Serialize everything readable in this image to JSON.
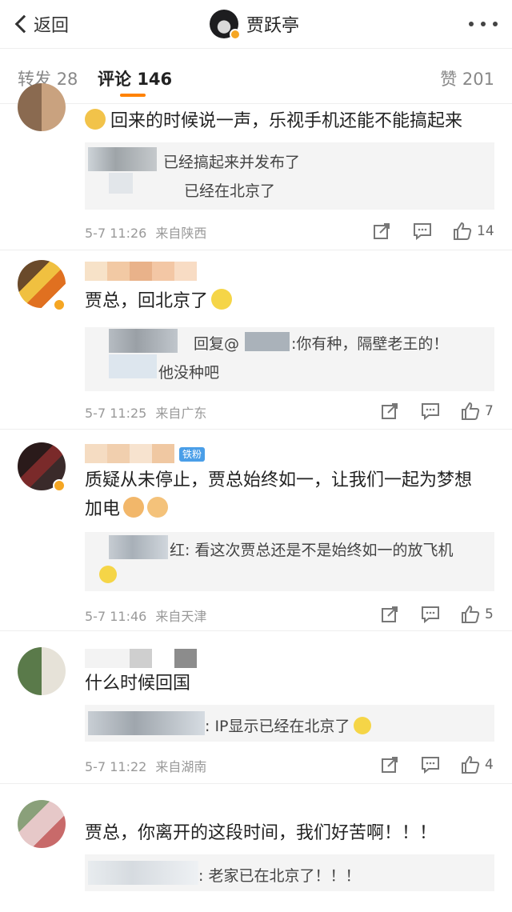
{
  "nav": {
    "back_label": "返回",
    "title": "贾跃亭"
  },
  "tabs": {
    "repost_label": "转发",
    "repost_count": "28",
    "comment_label": "评论",
    "comment_count": "146",
    "like_label": "赞",
    "like_count": "201"
  },
  "comments": [
    {
      "text": "回来的时候说一声，乐视手机还能不能搞起来",
      "replies": [
        "已经搞起来并发布了",
        "已经在北京了"
      ],
      "time": "5-7 11:26",
      "source": "来自陕西",
      "likes": "14"
    },
    {
      "text": "贾总，回北京了",
      "reply_line1_a": "回复@",
      "reply_line1_b": ":你有种，隔壁老王的！",
      "reply_line2": "他没种吧",
      "time": "5-7 11:25",
      "source": "来自广东",
      "likes": "7"
    },
    {
      "badge": "铁粉",
      "text_line1": "质疑从未停止，贾总始终如一，让我们一起为梦想",
      "text_line2": "加电",
      "reply": "红: 看这次贾总还是不是始终如一的放飞机",
      "time": "5-7 11:46",
      "source": "来自天津",
      "likes": "5"
    },
    {
      "text": "什么时候回国",
      "reply": ": IP显示已经在北京了",
      "time": "5-7 11:22",
      "source": "来自湖南",
      "likes": "4"
    },
    {
      "text": "贾总，你离开的这段时间，我们好苦啊！！！",
      "reply": ": 老家已在北京了！！！"
    }
  ],
  "colors": {
    "accent": "#ff8200",
    "fan_badge": "#4a9ee8",
    "verified": "#f5a623"
  }
}
